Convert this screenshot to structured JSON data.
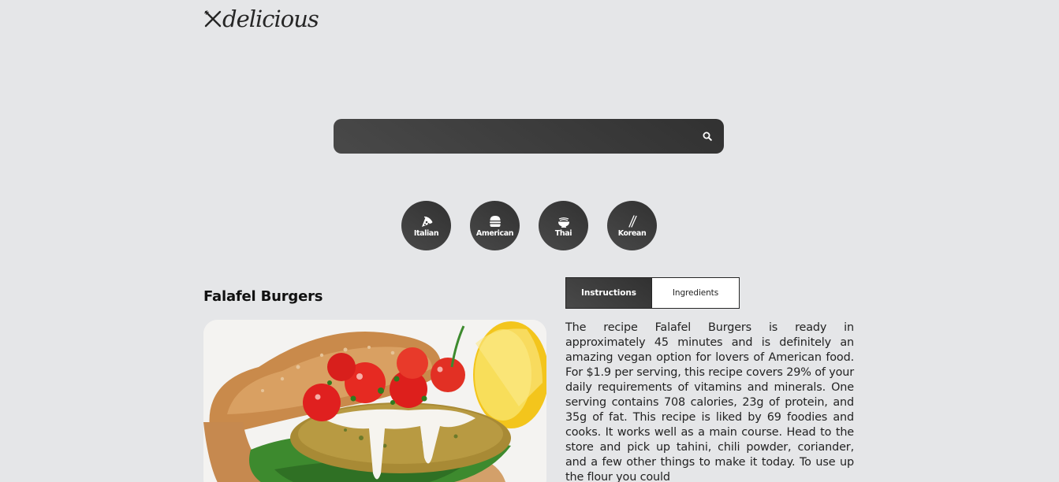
{
  "logo": {
    "text": "delicious",
    "icon": "fork-knife-icon"
  },
  "search": {
    "placeholder": "",
    "value": "",
    "icon": "search-icon"
  },
  "categories": [
    {
      "label": "Italian",
      "icon": "pizza-icon"
    },
    {
      "label": "American",
      "icon": "burger-icon"
    },
    {
      "label": "Thai",
      "icon": "noodle-bowl-icon"
    },
    {
      "label": "Korean",
      "icon": "chopsticks-icon"
    }
  ],
  "recipe": {
    "title": "Falafel Burgers",
    "image_alt": "Falafel Burgers",
    "tabs": [
      {
        "label": "Instructions",
        "active": true
      },
      {
        "label": "Ingredients",
        "active": false
      }
    ],
    "description": "The recipe Falafel Burgers is ready in approximately 45 minutes and is definitely an amazing vegan option for lovers of American food. For $1.9 per serving, this recipe covers 29% of your daily requirements of vitamins and minerals. One serving contains 708 calories, 23g of protein, and 35g of fat. This recipe is liked by 69 foodies and cooks. It works well as a main course. Head to the store and pick up tahini, chili powder, coriander, and a few other things to make it today. To use up the flour you could"
  },
  "colors": {
    "background": "#e5e6e8",
    "dark_gradient_start": "#494949",
    "dark_gradient_end": "#313131"
  }
}
